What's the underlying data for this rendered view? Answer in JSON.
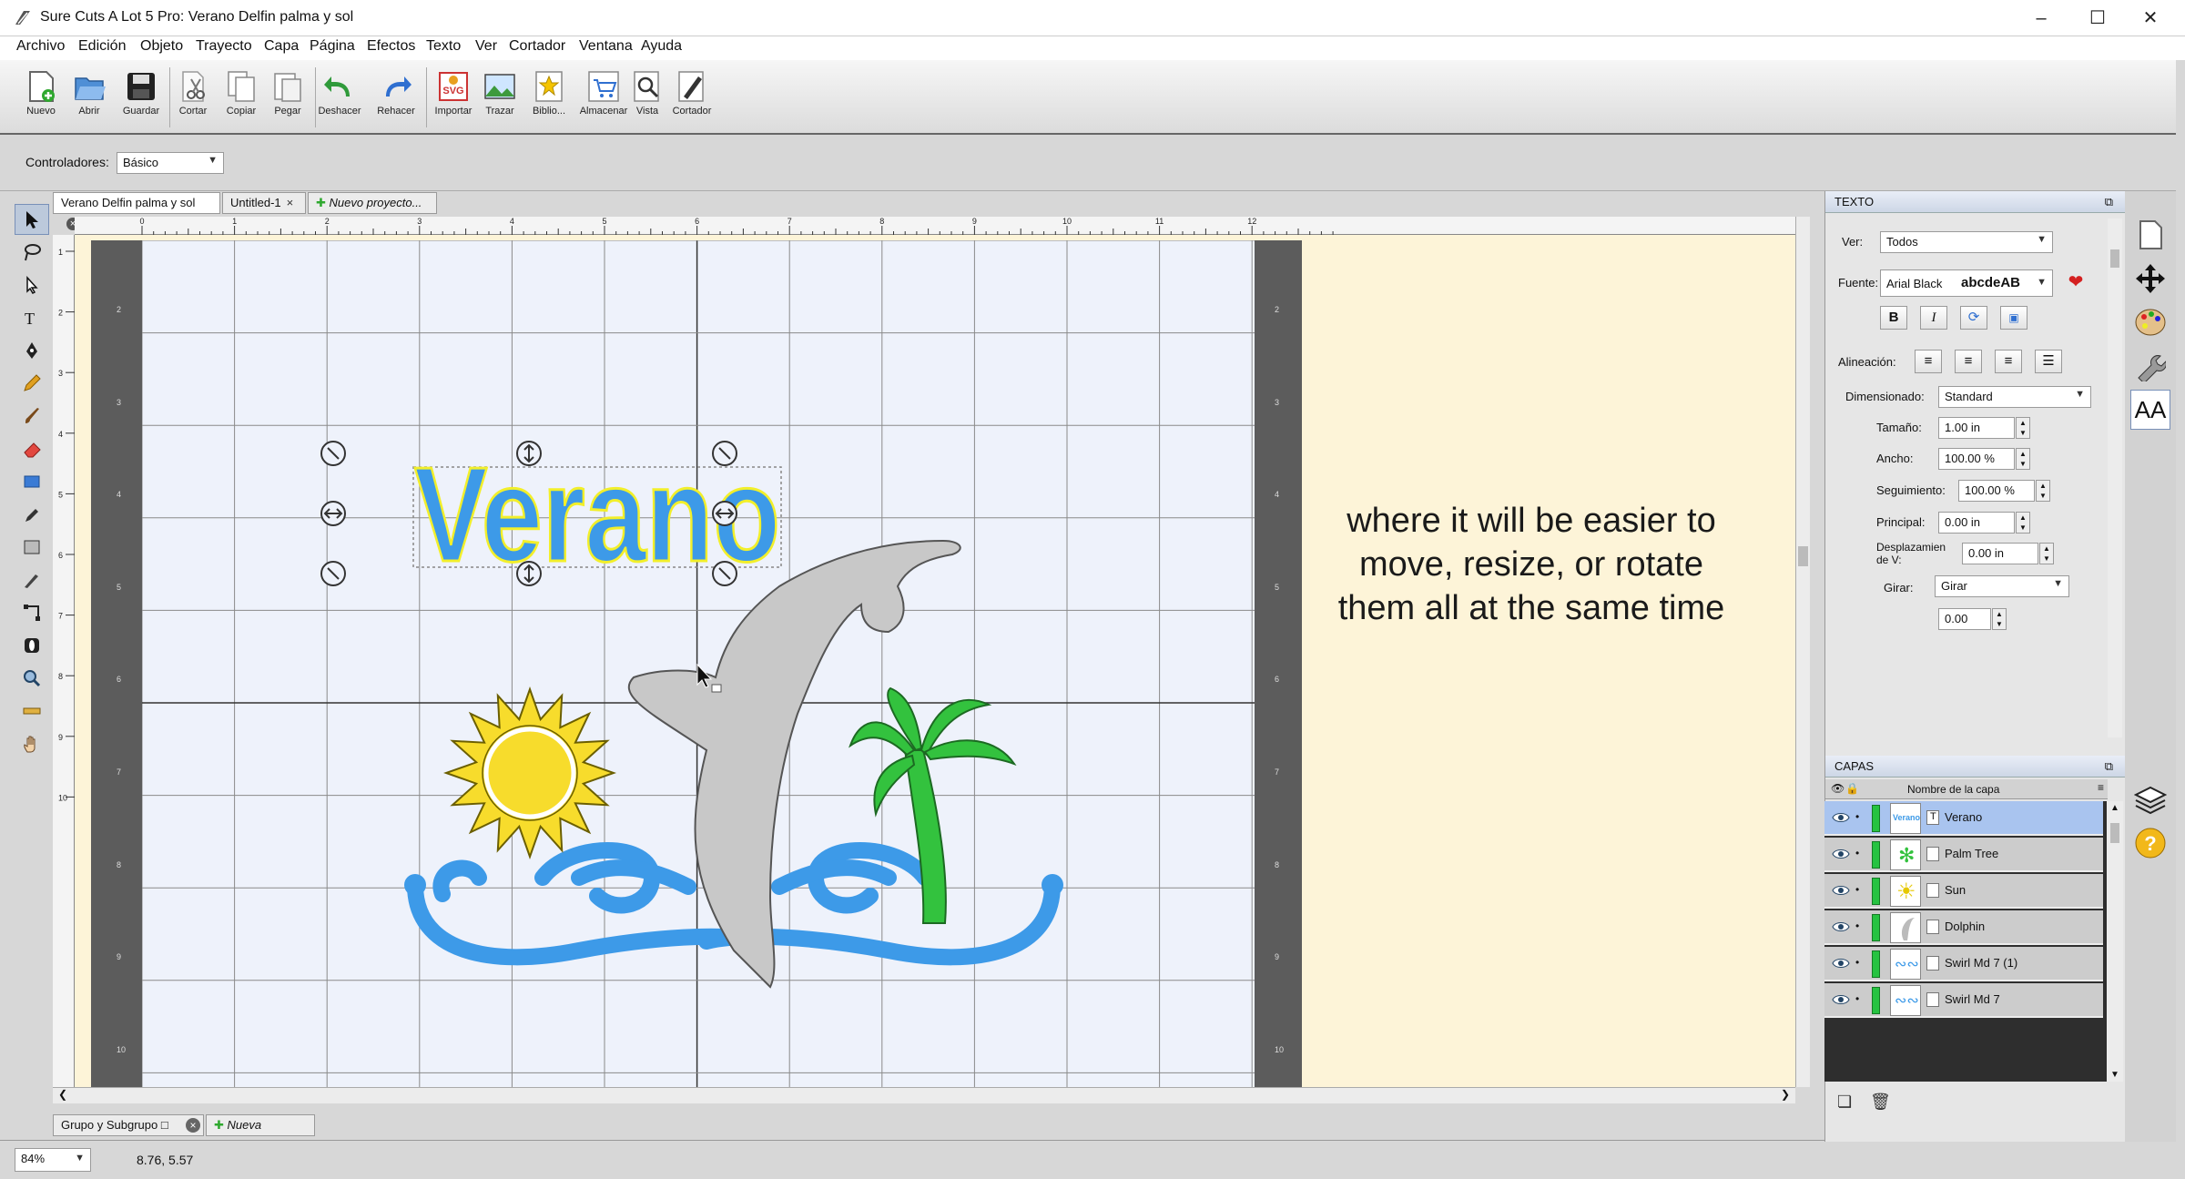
{
  "window": {
    "title": "Sure Cuts A Lot 5 Pro: Verano Delfin palma y sol"
  },
  "menu": [
    "Archivo",
    "Edición",
    "Objeto",
    "Trayecto",
    "Capa",
    "Página",
    "Efectos",
    "Texto",
    "Ver",
    "Cortador",
    "Ventana",
    "Ayuda"
  ],
  "toolbar": [
    "Nuevo",
    "Abrir",
    "Guardar",
    "Cortar",
    "Copiar",
    "Pegar",
    "Deshacer",
    "Rehacer",
    "Importar",
    "Trazar",
    "Biblio...",
    "Almacenar",
    "Vista",
    "Cortador"
  ],
  "controllers": {
    "label": "Controladores:",
    "value": "Básico"
  },
  "tabs": [
    "Verano Delfin palma y sol",
    "Untitled-1",
    "Nuevo proyecto..."
  ],
  "ruler": {
    "h_labels": [
      "0",
      "1",
      "2",
      "3",
      "4",
      "5",
      "6",
      "7",
      "8",
      "9",
      "10",
      "11",
      "12"
    ],
    "v_labels": [
      "1",
      "2",
      "3",
      "4",
      "5",
      "6",
      "7",
      "8",
      "9",
      "10"
    ],
    "mat_v_labels": [
      "2",
      "3",
      "4",
      "5",
      "6",
      "7",
      "8",
      "9",
      "10"
    ]
  },
  "canvas": {
    "artwork_text": "Verano",
    "caption": "where it will be easier to move, resize, or rotate them all at the same time"
  },
  "pages": [
    "Grupo y Subgrupo",
    "Nueva página..."
  ],
  "status": {
    "zoom": "84%",
    "coords": "8.76, 5.57"
  },
  "text_panel": {
    "title": "TEXTO",
    "view_label": "Ver:",
    "view_value": "Todos",
    "font_label": "Fuente:",
    "font_name": "Arial Black",
    "font_sample": "abcdeAB",
    "alignment_label": "Alineación:",
    "sizing_label": "Dimensionado:",
    "sizing_value": "Standard",
    "size_label": "Tamaño:",
    "size_value": "1.00 in",
    "width_label": "Ancho:",
    "width_value": "100.00 %",
    "tracking_label": "Seguimiento:",
    "tracking_value": "100.00 %",
    "leading_label": "Principal:",
    "leading_value": "0.00 in",
    "voffset_label": "Desplazamien de V:",
    "voffset_value": "0.00 in",
    "rotate_label": "Girar:",
    "rotate_mode": "Girar",
    "rotate_value": "0.00"
  },
  "layers_panel": {
    "title": "CAPAS",
    "column_header": "Nombre de la capa"
  },
  "layers": [
    "Verano",
    "Palm Tree",
    "Sun",
    "Dolphin",
    "Swirl Md 7 (1)",
    "Swirl Md 7"
  ],
  "colors": {
    "text_fill": "#3d9ae8",
    "text_outline": "#f2ef2a",
    "sun": "#f7dc2c",
    "palm": "#33c23e",
    "dolphin": "#c8c8c8",
    "mat": "#eef2fb",
    "background": "#fdf4d8",
    "layer_swatch": "#26c341"
  }
}
